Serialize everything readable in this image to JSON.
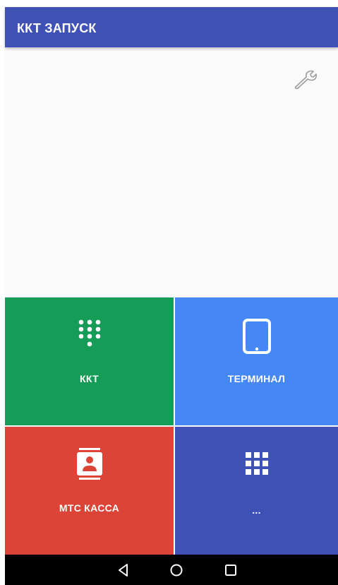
{
  "app": {
    "title": "ККТ ЗАПУСК"
  },
  "toolbar": {
    "settings_icon": "wrench-icon"
  },
  "tiles": [
    {
      "label": "ККТ",
      "icon": "dialpad-icon",
      "color": "#159d58"
    },
    {
      "label": "ТЕРМИНАЛ",
      "icon": "tablet-icon",
      "color": "#4587f3"
    },
    {
      "label": "МТС КАССА",
      "icon": "contact-card-icon",
      "color": "#dc4437"
    },
    {
      "label": "...",
      "icon": "apps-grid-icon",
      "color": "#3f51b5"
    }
  ],
  "navbar": {
    "buttons": [
      "back-icon",
      "home-icon",
      "recents-icon"
    ]
  },
  "colors": {
    "appbar": "#3f51b5",
    "background": "#fafafa"
  }
}
